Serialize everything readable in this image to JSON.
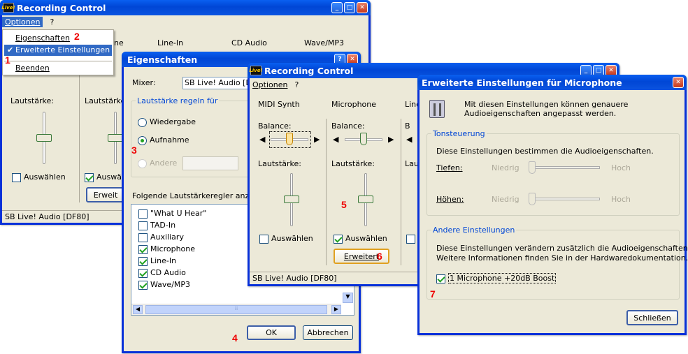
{
  "win1": {
    "title": "Recording Control",
    "menu_options": "Optionen",
    "menu_help": "?",
    "col_line_in": "Line-In",
    "col_cd": "CD Audio",
    "col_wave": "Wave/MP3",
    "col_partial": "ne",
    "volume_a": "Lautstärke:",
    "volume_b": "Lautstärke:",
    "select_a": "Auswählen",
    "select_b": "Auswäh",
    "advanced": "Erweit",
    "status": "SB Live! Audio [DF80]"
  },
  "dropdown": {
    "items": [
      "Eigenschaften",
      "Erweiterte Einstellungen",
      "Beenden"
    ]
  },
  "props": {
    "title": "Eigenschaften",
    "mixer_label": "Mixer:",
    "mixer_value": "SB Live! Audio [DF8",
    "group_label": "Lautstärke regeln für",
    "radio_playback": "Wiedergabe",
    "radio_record": "Aufnahme",
    "radio_other": "Andere",
    "list_label": "Folgende Lautstärkeregler anzeigen:",
    "list": [
      {
        "label": "\"What U Hear\"",
        "checked": false
      },
      {
        "label": "TAD-In",
        "checked": false
      },
      {
        "label": "Auxiliary",
        "checked": false
      },
      {
        "label": "Microphone",
        "checked": true
      },
      {
        "label": "Line-In",
        "checked": true
      },
      {
        "label": "CD Audio",
        "checked": true
      },
      {
        "label": "Wave/MP3",
        "checked": true
      }
    ],
    "ok": "OK",
    "cancel": "Abbrechen"
  },
  "win3": {
    "title": "Recording Control",
    "menu_options": "Optionen",
    "menu_help": "?",
    "col_midi": "MIDI Synth",
    "col_mic": "Microphone",
    "col_partial": "Line",
    "balance_a": "Balance:",
    "balance_b": "Balance:",
    "balance_c": "B",
    "volume_a": "Lautstärke:",
    "volume_b": "Lautstärke:",
    "volume_c": "Lau",
    "select_a": "Auswählen",
    "select_b": "Auswählen",
    "advanced": "Erweitert",
    "status": "SB Live! Audio [DF80]"
  },
  "adv": {
    "title": "Erweiterte Einstellungen für Microphone",
    "intro": "Mit diesen Einstellungen können genauere Audioeigenschaften angepasst werden.",
    "tone_group": "Tonsteuerung",
    "tone_desc": "Diese Einstellungen bestimmen die Audioeigenschaften.",
    "bass": "Tiefen:",
    "treble": "Höhen:",
    "low": "Niedrig",
    "high": "Hoch",
    "other_group": "Andere Einstellungen",
    "other_desc1": "Diese Einstellungen verändern zusätzlich die Audioeigenschaften.",
    "other_desc2": "Weitere Informationen finden Sie in der Hardwaredokumentation.",
    "boost": "1  Microphone +20dB Boost",
    "close": "Schließen"
  },
  "annotations": [
    "1",
    "2",
    "3",
    "4",
    "5",
    "6",
    "7"
  ],
  "colors": {
    "titlebar": "#0054e3",
    "annotation": "#e00000",
    "selection": "#316ac5"
  }
}
